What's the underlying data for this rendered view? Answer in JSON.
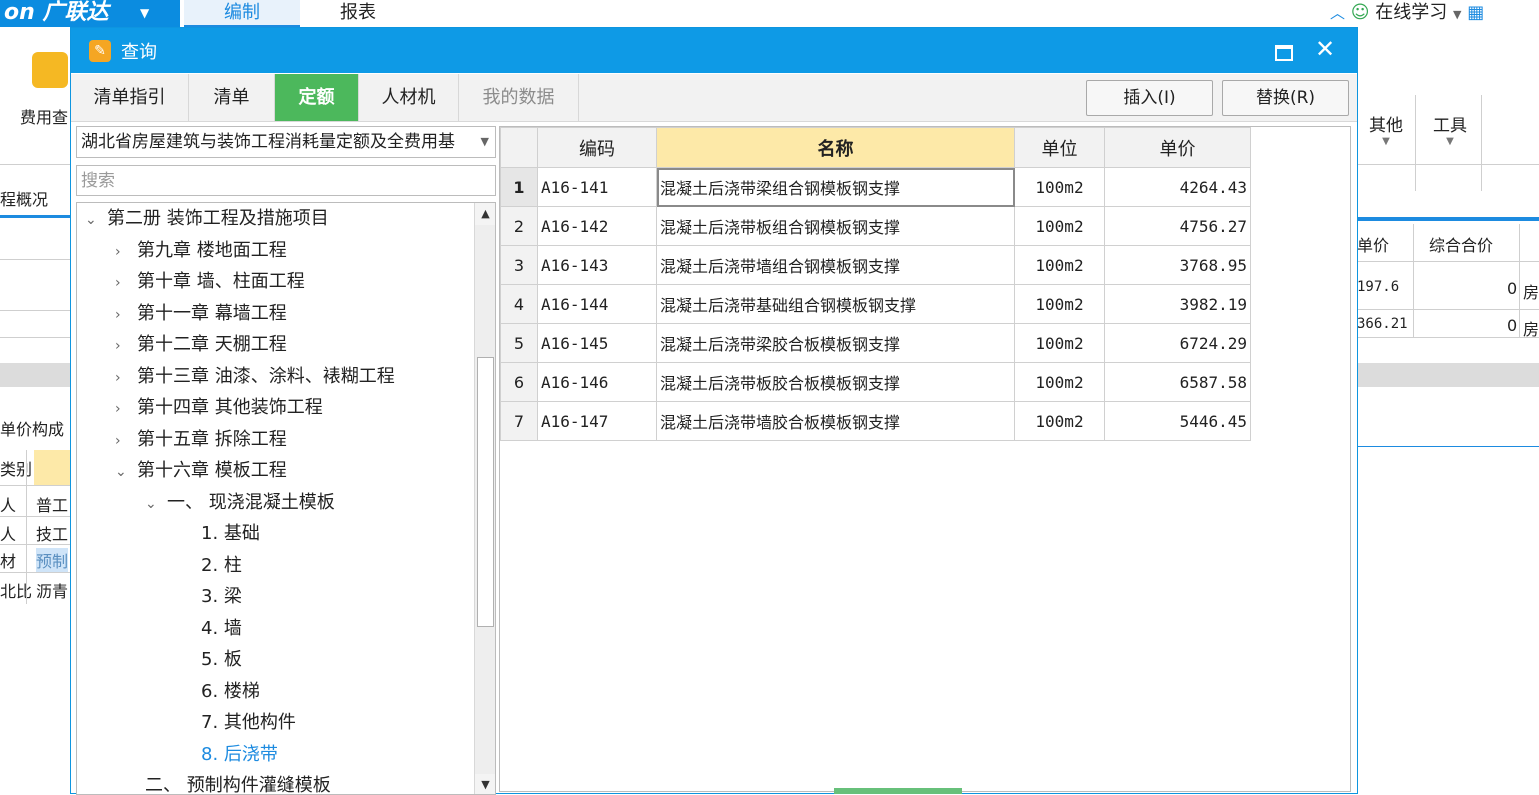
{
  "app": {
    "brand": "广联达",
    "top_tabs": [
      "编制",
      "报表"
    ],
    "online_learning": "在线学习"
  },
  "background": {
    "ribbon_left_label": "费用查",
    "ribbon_right": [
      "其他",
      "工具"
    ],
    "left_side": [
      "程概况",
      "单价构成",
      "类别",
      "人",
      "人",
      "材",
      "北比"
    ],
    "left_side_cols": [
      "普工",
      "技工",
      "预制",
      "沥青"
    ],
    "right_headers": [
      "单价",
      "综合合价"
    ],
    "right_rows": [
      {
        "price": "197.6",
        "total": "0",
        "tag": "房"
      },
      {
        "price": "366.21",
        "total": "0",
        "tag": "房"
      }
    ]
  },
  "dialog": {
    "title": "查询",
    "tabs": [
      {
        "label": "清单指引",
        "state": "normal"
      },
      {
        "label": "清单",
        "state": "normal"
      },
      {
        "label": "定额",
        "state": "active"
      },
      {
        "label": "人材机",
        "state": "normal"
      },
      {
        "label": "我的数据",
        "state": "disabled"
      }
    ],
    "insert_button": "插入(I)",
    "replace_button": "替换(R)",
    "library": "湖北省房屋建筑与装饰工程消耗量定额及全费用基",
    "search_placeholder": "搜索",
    "tree": [
      {
        "level": 0,
        "arrow": "open",
        "label": "第二册 装饰工程及措施项目"
      },
      {
        "level": 1,
        "arrow": "closed",
        "label": "第九章 楼地面工程"
      },
      {
        "level": 1,
        "arrow": "closed",
        "label": "第十章 墙、柱面工程"
      },
      {
        "level": 1,
        "arrow": "closed",
        "label": "第十一章 幕墙工程"
      },
      {
        "level": 1,
        "arrow": "closed",
        "label": "第十二章 天棚工程"
      },
      {
        "level": 1,
        "arrow": "closed",
        "label": "第十三章 油漆、涂料、裱糊工程"
      },
      {
        "level": 1,
        "arrow": "closed",
        "label": "第十四章 其他装饰工程"
      },
      {
        "level": 1,
        "arrow": "closed",
        "label": "第十五章 拆除工程"
      },
      {
        "level": 1,
        "arrow": "open",
        "label": "第十六章 模板工程"
      },
      {
        "level": 2,
        "arrow": "open",
        "label": "一、 现浇混凝土模板"
      },
      {
        "level": 3,
        "arrow": "none",
        "label": "1. 基础"
      },
      {
        "level": 3,
        "arrow": "none",
        "label": "2. 柱"
      },
      {
        "level": 3,
        "arrow": "none",
        "label": "3. 梁"
      },
      {
        "level": 3,
        "arrow": "none",
        "label": "4. 墙"
      },
      {
        "level": 3,
        "arrow": "none",
        "label": "5. 板"
      },
      {
        "level": 3,
        "arrow": "none",
        "label": "6. 楼梯"
      },
      {
        "level": 3,
        "arrow": "none",
        "label": "7. 其他构件"
      },
      {
        "level": 3,
        "arrow": "none",
        "label": "8. 后浇带",
        "selected": true
      },
      {
        "level": 2,
        "arrow": "none",
        "label": "二、 预制构件灌缝模板"
      }
    ],
    "grid": {
      "headers": [
        "编码",
        "名称",
        "单位",
        "单价"
      ],
      "rows": [
        {
          "n": "1",
          "code": "A16-141",
          "name": "混凝土后浇带梁组合钢模板钢支撑",
          "unit": "100m2",
          "price": "4264.43"
        },
        {
          "n": "2",
          "code": "A16-142",
          "name": "混凝土后浇带板组合钢模板钢支撑",
          "unit": "100m2",
          "price": "4756.27"
        },
        {
          "n": "3",
          "code": "A16-143",
          "name": "混凝土后浇带墙组合钢模板钢支撑",
          "unit": "100m2",
          "price": "3768.95"
        },
        {
          "n": "4",
          "code": "A16-144",
          "name": "混凝土后浇带基础组合钢模板钢支撑",
          "unit": "100m2",
          "price": "3982.19"
        },
        {
          "n": "5",
          "code": "A16-145",
          "name": "混凝土后浇带梁胶合板模板钢支撑",
          "unit": "100m2",
          "price": "6724.29"
        },
        {
          "n": "6",
          "code": "A16-146",
          "name": "混凝土后浇带板胶合板模板钢支撑",
          "unit": "100m2",
          "price": "6587.58"
        },
        {
          "n": "7",
          "code": "A16-147",
          "name": "混凝土后浇带墙胶合板模板钢支撑",
          "unit": "100m2",
          "price": "5446.45"
        }
      ]
    }
  },
  "colors": {
    "title_bar": "#0e9ae6",
    "active_tab": "#4cb85c",
    "header_highlight": "#fde9a8",
    "selected_tree_item": "#1d8be0"
  }
}
